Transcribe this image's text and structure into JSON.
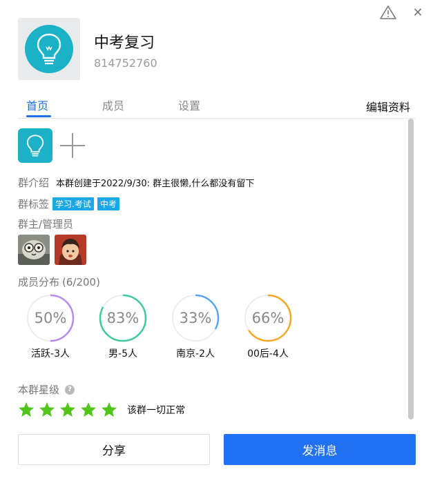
{
  "group": {
    "name": "中考复习",
    "id": "814752760",
    "avatar_icon": "lightbulb-icon",
    "avatar_color": "#1bb1c6"
  },
  "tabs": [
    {
      "label": "首页",
      "active": true
    },
    {
      "label": "成员",
      "active": false
    },
    {
      "label": "设置",
      "active": false
    }
  ],
  "edit_label": "编辑资料",
  "intro": {
    "label": "群介绍",
    "text": "本群创建于2022/9/30:  群主很懒,什么都没有留下"
  },
  "tags": {
    "label": "群标签",
    "items": [
      "学习.考试",
      "中考"
    ]
  },
  "admins": {
    "label": "群主/管理员"
  },
  "distribution": {
    "label": "成员分布",
    "count": "(6/200)",
    "stats": [
      {
        "percent": "50%",
        "value": 0.5,
        "label": "活跃-3人",
        "color": "#b48be8"
      },
      {
        "percent": "83%",
        "value": 0.83,
        "label": "男-5人",
        "color": "#3ec99a"
      },
      {
        "percent": "33%",
        "value": 0.33,
        "label": "南京-2人",
        "color": "#5aa3f0"
      },
      {
        "percent": "66%",
        "value": 0.66,
        "label": "00后-4人",
        "color": "#f5a623"
      }
    ]
  },
  "rating": {
    "label": "本群星级",
    "help": "?",
    "stars": 5,
    "star_color": "#52c41a",
    "note": "该群一切正常"
  },
  "buttons": {
    "share": "分享",
    "send": "发消息"
  },
  "colors": {
    "accent": "#1f6fe5",
    "send_button": "#2172f3",
    "tag": "#1ba8e8"
  }
}
